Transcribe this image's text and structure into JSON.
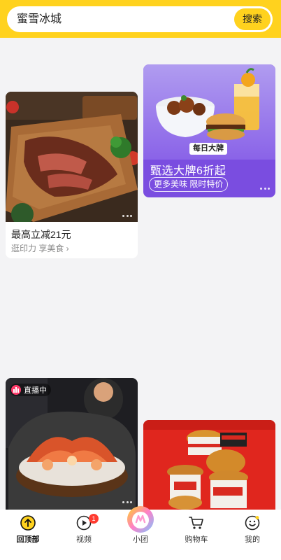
{
  "search": {
    "query": "蜜雪冰城",
    "button_label": "搜索"
  },
  "cards": {
    "steak": {
      "title": "最高立减21元",
      "subtitle": "逛印力 享美食 ›"
    },
    "promo": {
      "badge": "每日大牌",
      "title": "甄选大牌6折起",
      "chip": "更多美味  限时特价"
    },
    "live": {
      "label": "直播中"
    }
  },
  "tabbar": {
    "items": [
      {
        "label": "回顶部",
        "icon": "arrow-up-circle-icon"
      },
      {
        "label": "视频",
        "icon": "video-play-icon",
        "badge": "1"
      },
      {
        "label": "小团",
        "icon": "mascot-icon"
      },
      {
        "label": "购物车",
        "icon": "cart-icon"
      },
      {
        "label": "我的",
        "icon": "smiley-icon"
      }
    ]
  },
  "colors": {
    "brand_yellow": "#ffd21e",
    "promo_purple": "#7a4de0",
    "badge_red": "#ff3b30"
  }
}
